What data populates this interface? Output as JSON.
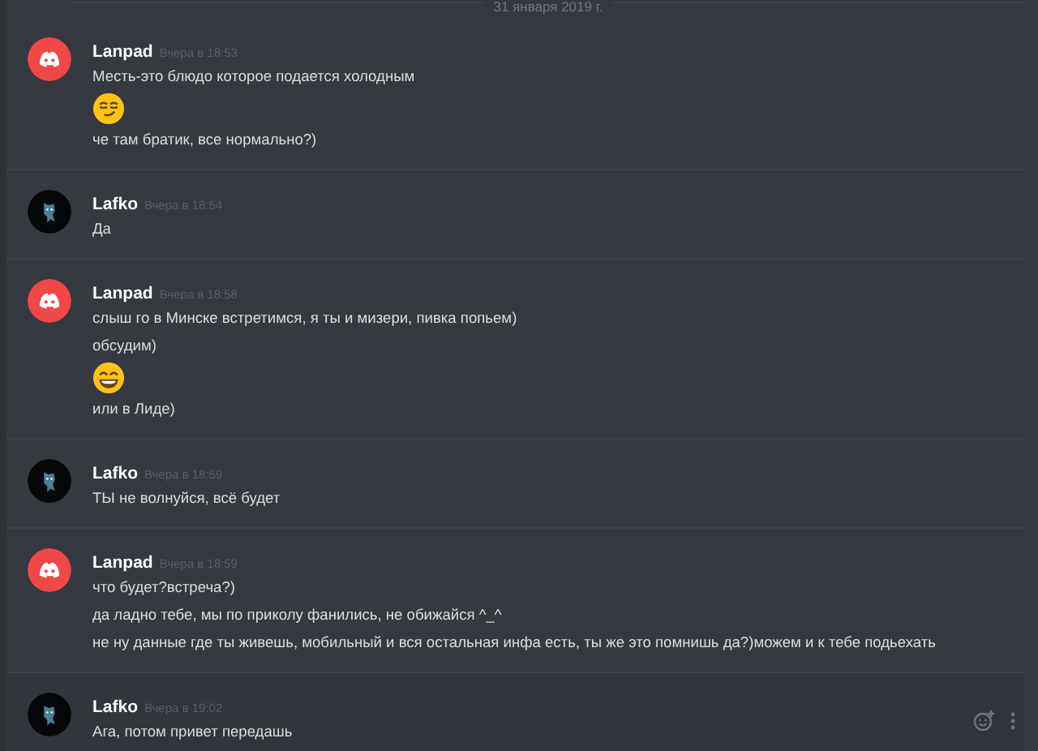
{
  "date_divider": "31 января 2019 г.",
  "messages": [
    {
      "author": "Lanpad",
      "kind": "logo-avatar",
      "timestamp": "Вчера в 18:53",
      "hovered": false,
      "lines": [
        {
          "kind": "text",
          "text": "Месть-это блюдо которое подается холодным"
        },
        {
          "kind": "smirk"
        },
        {
          "kind": "text",
          "text": "че там братик, все нормально?)"
        }
      ]
    },
    {
      "author": "Lafko",
      "kind": "photo-avatar",
      "timestamp": "Вчера в 18:54",
      "hovered": false,
      "lines": [
        {
          "kind": "text",
          "text": "Да"
        }
      ]
    },
    {
      "author": "Lanpad",
      "kind": "logo-avatar",
      "timestamp": "Вчера в 18:58",
      "hovered": false,
      "lines": [
        {
          "kind": "text",
          "text": "слыш го в Минске встретимся, я ты и мизери, пивка попьем)"
        },
        {
          "kind": "text",
          "text": "обсудим)"
        },
        {
          "kind": "grin"
        },
        {
          "kind": "text",
          "text": "или в Лиде)"
        }
      ]
    },
    {
      "author": "Lafko",
      "kind": "photo-avatar",
      "timestamp": "Вчера в 18:59",
      "hovered": false,
      "lines": [
        {
          "kind": "text",
          "text": "ТЫ не волнуйся, всё будет"
        }
      ]
    },
    {
      "author": "Lanpad",
      "kind": "logo-avatar",
      "timestamp": "Вчера в 18:59",
      "hovered": false,
      "lines": [
        {
          "kind": "text",
          "text": "что будет?встреча?)"
        },
        {
          "kind": "text",
          "text": "да ладно тебе, мы по приколу фанились, не обижайся ^_^"
        },
        {
          "kind": "text",
          "text": "не ну данные где ты живешь, мобильный и вся остальная инфа есть, ты же это помнишь да?)можем и к тебе подьехать"
        }
      ]
    },
    {
      "author": "Lafko",
      "kind": "photo-avatar",
      "timestamp": "Вчера в 19:02",
      "hovered": true,
      "lines": [
        {
          "kind": "text",
          "text": "Ага, потом привет передашь"
        }
      ]
    }
  ]
}
